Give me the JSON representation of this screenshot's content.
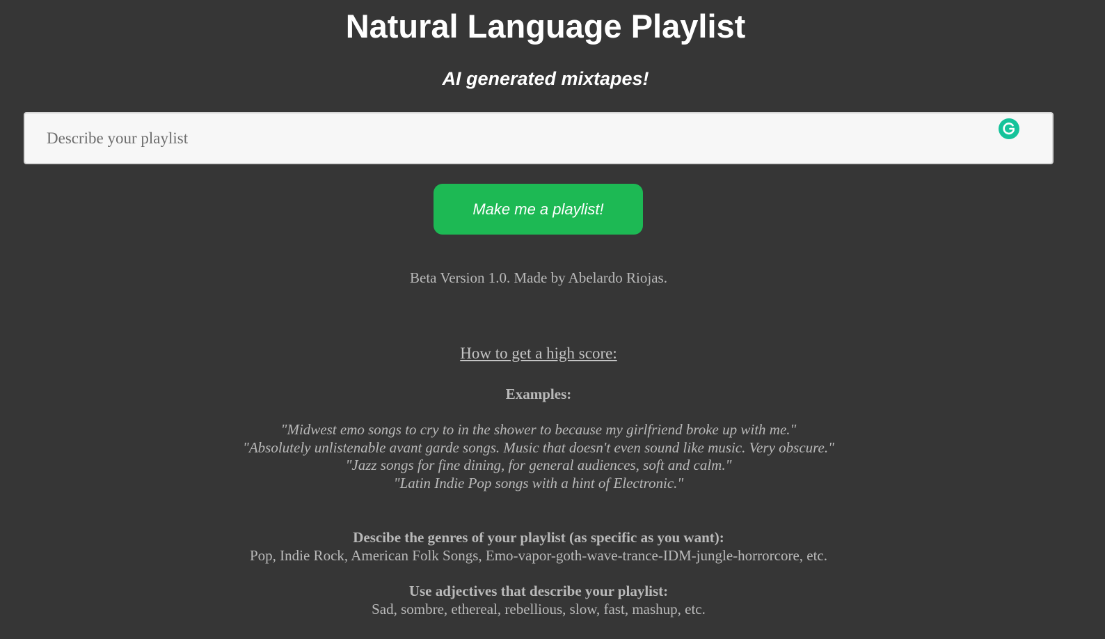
{
  "header": {
    "title": "Natural Language Playlist",
    "subtitle": "AI generated mixtapes!"
  },
  "search": {
    "placeholder": "Describe your playlist",
    "value": ""
  },
  "extension_icon": "grammarly-icon",
  "action": {
    "button_label": "Make me a playlist!",
    "button_color": "#1db954"
  },
  "footer": {
    "version_text": "Beta Version 1.0. Made by Abelardo Riojas."
  },
  "guide": {
    "link_text": "How to get a high score:",
    "examples_heading": "Examples:",
    "examples": [
      "\"Midwest emo songs to cry to in the shower to because my girlfriend broke up with me.\"",
      "\"Absolutely unlistenable avant garde songs. Music that doesn't even sound like music. Very obscure.\"",
      "\"Jazz songs for fine dining, for general audiences, soft and calm.\"",
      "\"Latin Indie Pop songs with a hint of Electronic.\""
    ],
    "genres_heading": "Descibe the genres of your playlist (as specific as you want):",
    "genres_text": "Pop, Indie Rock, American Folk Songs, Emo-vapor-goth-wave-trance-IDM-jungle-horrorcore, etc.",
    "adjectives_heading": "Use adjectives that describe your playlist:",
    "adjectives_text": "Sad, sombre, ethereal, rebellious, slow, fast, mashup, etc."
  },
  "colors": {
    "background": "#363636",
    "text": "#b9b9b9",
    "heading": "#ffffff"
  }
}
